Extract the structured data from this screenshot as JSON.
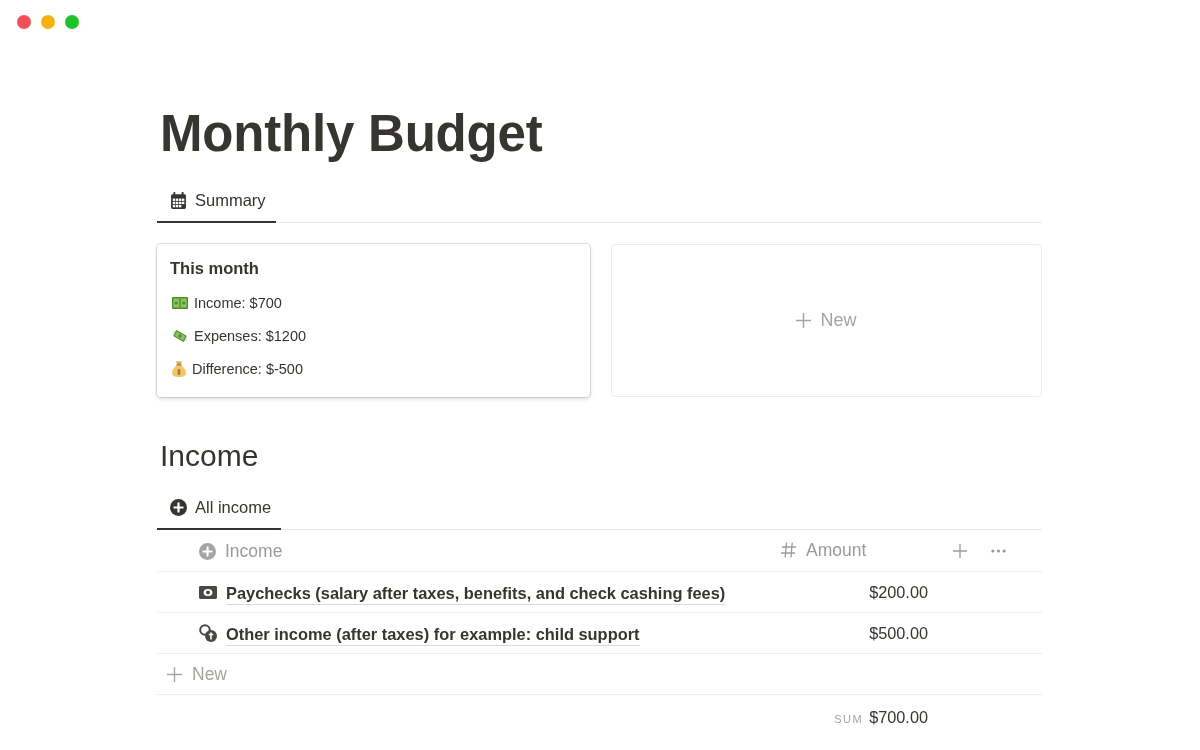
{
  "window": {
    "controls": [
      {
        "color": "#f25056"
      },
      {
        "color": "#f9b112"
      },
      {
        "color": "#1dc32a"
      }
    ]
  },
  "page": {
    "title": "Monthly Budget"
  },
  "summary": {
    "tabs": [
      {
        "label": "Summary",
        "selected": true
      }
    ],
    "cards": [
      {
        "kind": "summary",
        "title": "This month",
        "lines": [
          {
            "kind": "bills",
            "text": "Income: $700"
          },
          {
            "kind": "flying-money",
            "text": "Expenses: $1200"
          },
          {
            "kind": "money-bag",
            "text": "Difference: $-500"
          }
        ]
      },
      {
        "kind": "new",
        "label": "New"
      }
    ]
  },
  "income": {
    "heading": "Income",
    "tabs": [
      {
        "label": "All income",
        "selected": true
      }
    ],
    "table": {
      "columns": [
        {
          "kind": "title",
          "label": "Income"
        },
        {
          "kind": "number",
          "label": "Amount"
        }
      ],
      "rows": [
        {
          "kind": "banknote",
          "name": "Paychecks (salary after taxes, benefits, and check cashing fees)",
          "amount": "$200.00"
        },
        {
          "kind": "coins",
          "name": "Other income (after taxes) for example: child support",
          "amount": "$500.00"
        }
      ],
      "new_row": {
        "label": "New"
      },
      "footer": {
        "label": "SUM",
        "value": "$700.00"
      }
    }
  }
}
